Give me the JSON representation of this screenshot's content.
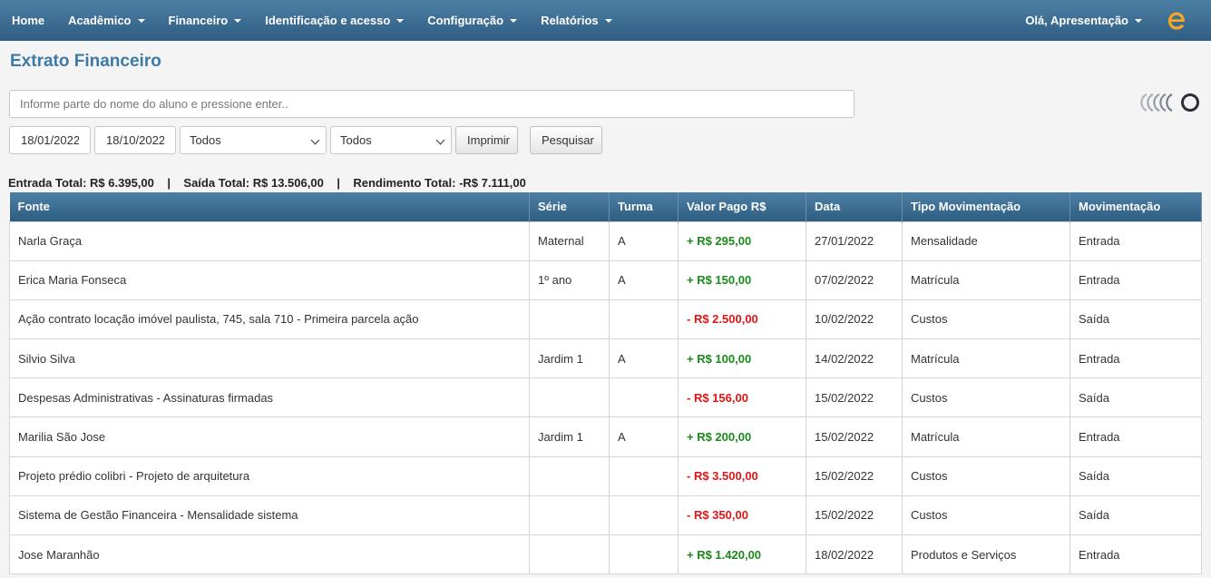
{
  "nav": {
    "items": [
      {
        "label": "Home",
        "dropdown": false
      },
      {
        "label": "Acadêmico",
        "dropdown": true
      },
      {
        "label": "Financeiro",
        "dropdown": true
      },
      {
        "label": "Identificação e acesso",
        "dropdown": true
      },
      {
        "label": "Configuração",
        "dropdown": true
      },
      {
        "label": "Relatórios",
        "dropdown": true
      }
    ],
    "user_label": "Olá, Apresentação"
  },
  "page_title": "Extrato Financeiro",
  "search": {
    "placeholder": "Informe parte do nome do aluno e pressione enter..",
    "value": ""
  },
  "filters": {
    "date_start": "18/01/2022",
    "date_end": "18/10/2022",
    "select_1": "Todos",
    "select_2": "Todos",
    "print_label": "Imprimir",
    "search_label": "Pesquisar"
  },
  "totals": "Entrada Total: R$ 6.395,00    |    Saída Total: R$ 13.506,00    |    Rendimento Total: -R$ 7.111,00",
  "table": {
    "headers": [
      "Fonte",
      "Série",
      "Turma",
      "Valor Pago R$",
      "Data",
      "Tipo Movimentação",
      "Movimentação"
    ],
    "rows": [
      {
        "fonte": "Narla Graça",
        "serie": "Maternal",
        "turma": "A",
        "valor": "+ R$ 295,00",
        "sign": "pos",
        "data": "27/01/2022",
        "tipo": "Mensalidade",
        "mov": "Entrada"
      },
      {
        "fonte": "Erica Maria Fonseca",
        "serie": "1º ano",
        "turma": "A",
        "valor": "+ R$ 150,00",
        "sign": "pos",
        "data": "07/02/2022",
        "tipo": "Matrícula",
        "mov": "Entrada"
      },
      {
        "fonte": "Ação contrato locação imóvel paulista, 745, sala 710 - Primeira parcela ação",
        "serie": "",
        "turma": "",
        "valor": "- R$ 2.500,00",
        "sign": "neg",
        "data": "10/02/2022",
        "tipo": "Custos",
        "mov": "Saída"
      },
      {
        "fonte": "Silvio Silva",
        "serie": "Jardim 1",
        "turma": "A",
        "valor": "+ R$ 100,00",
        "sign": "pos",
        "data": "14/02/2022",
        "tipo": "Matrícula",
        "mov": "Entrada"
      },
      {
        "fonte": "Despesas Administrativas - Assinaturas firmadas",
        "serie": "",
        "turma": "",
        "valor": "- R$ 156,00",
        "sign": "neg",
        "data": "15/02/2022",
        "tipo": "Custos",
        "mov": "Saída"
      },
      {
        "fonte": "Marilia São Jose",
        "serie": "Jardim 1",
        "turma": "A",
        "valor": "+ R$ 200,00",
        "sign": "pos",
        "data": "15/02/2022",
        "tipo": "Matrícula",
        "mov": "Entrada"
      },
      {
        "fonte": "Projeto prédio colibri - Projeto de arquitetura",
        "serie": "",
        "turma": "",
        "valor": "- R$ 3.500,00",
        "sign": "neg",
        "data": "15/02/2022",
        "tipo": "Custos",
        "mov": "Saída"
      },
      {
        "fonte": "Sistema de Gestão Financeira - Mensalidade sistema",
        "serie": "",
        "turma": "",
        "valor": "- R$ 350,00",
        "sign": "neg",
        "data": "15/02/2022",
        "tipo": "Custos",
        "mov": "Saída"
      },
      {
        "fonte": "Jose Maranhão",
        "serie": "",
        "turma": "",
        "valor": "+ R$ 1.420,00",
        "sign": "pos",
        "data": "18/02/2022",
        "tipo": "Produtos e Serviços",
        "mov": "Entrada"
      }
    ]
  },
  "colors": {
    "accent": "#3d7aa6",
    "positive": "#1a8a1a",
    "negative": "#e01515",
    "logo": "#f5a623"
  }
}
